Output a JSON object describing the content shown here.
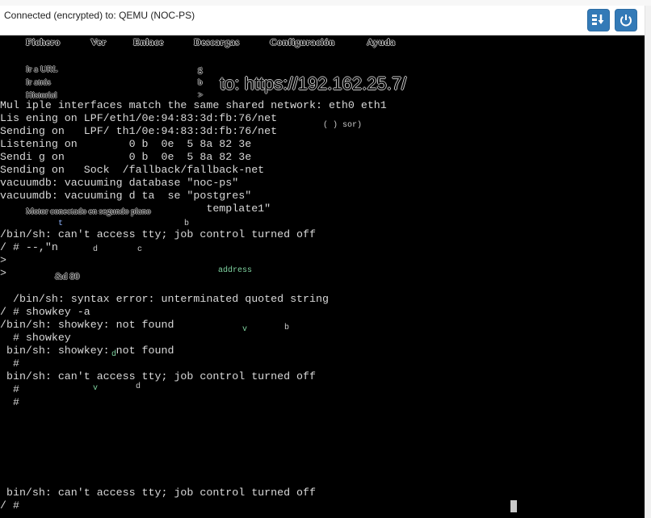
{
  "browser_strip": {
    "url_fragment": ""
  },
  "vnc": {
    "title": "Connected (encrypted) to: QEMU (NOC-PS)",
    "download_button_icon": "download-icon",
    "power_button_icon": "power-icon"
  },
  "ghost_menu": [
    "Fichero",
    "Ver",
    "Enlace",
    "Descargas",
    "Configuración",
    "Ayuda"
  ],
  "ghost_submenu": [
    "Ir a URL",
    "Ir atrás",
    "Historial"
  ],
  "ghost_url": "to: https://192.162.25.7/",
  "terminal_lines": [
    "Mul iple interfaces match the same shared network: eth0 eth1",
    "Lis ening on LPF/eth1/0e:94:83:3d:fb:76/net",
    "Sending on   LPF/ th1/0e:94:83:3d:fb:76/net",
    "Listening on        0 b  0e  5 8a 82 3e",
    "Sendi g on          0 b  0e  5 8a 82 3e",
    "Sending on   Sock  /fallback/fallback-net",
    "vacuumdb: vacuuming database \"noc-ps\"",
    "vacuumdb: vacuuming d ta  se \"postgres\"",
    "                                template1\"",
    "",
    "/bin/sh: can't access tty; job control turned off",
    "/ # --,\"n",
    ">",
    ">",
    "",
    "  /bin/sh: syntax error: unterminated quoted string",
    "/ # showkey -a",
    "/bin/sh: showkey: not found",
    "  # showkey",
    " bin/sh: showkey: not found",
    "  #",
    " bin/sh: can't access tty; job control turned off",
    "  #",
    "  #",
    "",
    "",
    "",
    "",
    "",
    " bin/sh: can't access tty; job control turned off",
    "/ #"
  ],
  "ghost_bits": {
    "motor": "Motor conectado en segundo plano",
    "amount": "&d 80",
    "address": "address",
    "conn": "(         )       sor)"
  },
  "colors": {
    "terminal_bg": "#000000",
    "terminal_fg": "#d9d9d9",
    "button_blue": "#337ab7"
  }
}
